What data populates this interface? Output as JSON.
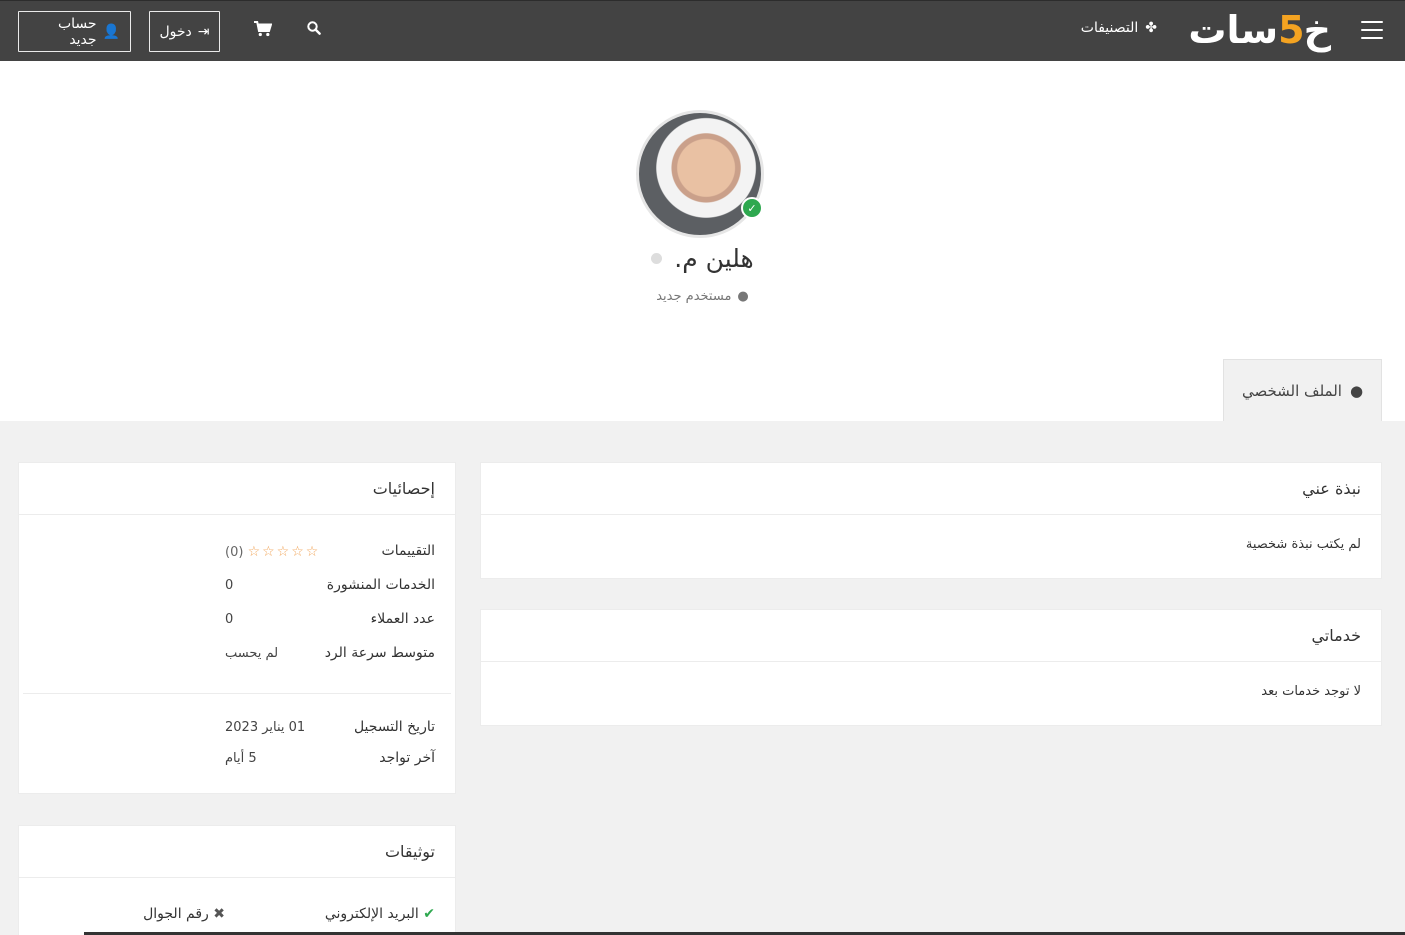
{
  "navbar": {
    "logo_prefix": "خ",
    "logo_five": "5",
    "logo_suffix": "سات",
    "categories_label": "التصنيفات",
    "login_label": "دخول",
    "register_label": "حساب جديد",
    "cart_icon": "cart-icon",
    "search_icon": "search-icon"
  },
  "profile": {
    "name": "هلين م.",
    "role": "مستخدم جديد",
    "tab_label": "الملف الشخصي"
  },
  "about": {
    "title": "نبذة عني",
    "text": "لم يكتب نبذة شخصية"
  },
  "services": {
    "title": "خدماتي",
    "text": "لا توجد خدمات بعد"
  },
  "stats": {
    "title": "إحصائيات",
    "rows": [
      {
        "label": "التقييمات",
        "value": "(0)"
      },
      {
        "label": "الخدمات المنشورة",
        "value": "0"
      },
      {
        "label": "عدد العملاء",
        "value": "0"
      },
      {
        "label": "متوسط سرعة الرد",
        "value": "لم يحسب"
      },
      {
        "label": "تاريخ التسجيل",
        "value": "01 يناير 2023"
      },
      {
        "label": "آخر تواجد",
        "value": "5 أيام"
      }
    ],
    "stars": "☆☆☆☆☆"
  },
  "verifications": {
    "title": "توثيقات",
    "email_label": "البريد الإلكتروني",
    "phone_label": "رقم الجوال"
  },
  "colors": {
    "navbar": "#434343",
    "accent": "#f4a321",
    "verified": "#2ea84f",
    "stars": "#f1a65b"
  }
}
